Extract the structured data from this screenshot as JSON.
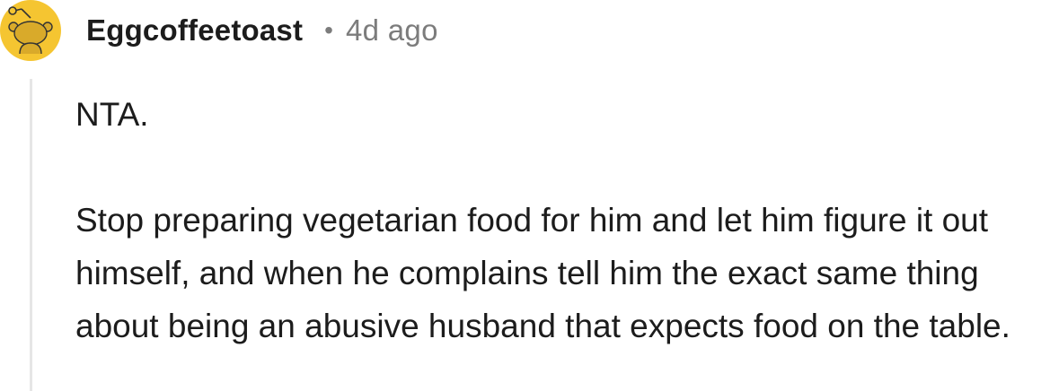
{
  "comment": {
    "author": "Eggcoffeetoast",
    "separator": "•",
    "timestamp": "4d ago",
    "avatar_icon": "snoo-avatar-icon",
    "avatar_color": "#f5c531",
    "paragraphs": [
      "NTA.",
      "Stop preparing vegetarian food for him and let him figure it out himself, and when he complains tell him the exact same thing about being an abusive husband that expects food on the table."
    ]
  }
}
